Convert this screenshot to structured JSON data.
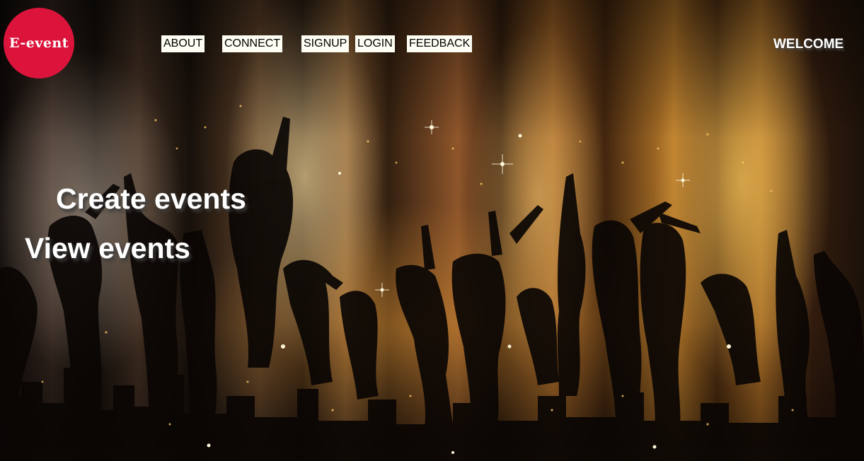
{
  "brand": {
    "logo_text": "E-event",
    "logo_color": "#dc143c"
  },
  "nav": {
    "about": "ABOUT",
    "connect": "CONNECT",
    "signup": "SIGNUP",
    "login": "LOGIN",
    "feedback": "FEEDBACK"
  },
  "header": {
    "welcome": "WELCOME"
  },
  "hero": {
    "create_events": "Create events",
    "view_events": "View events",
    "background_image": "silhouettes of people dancing at a concert with orange lights and sparkles"
  }
}
